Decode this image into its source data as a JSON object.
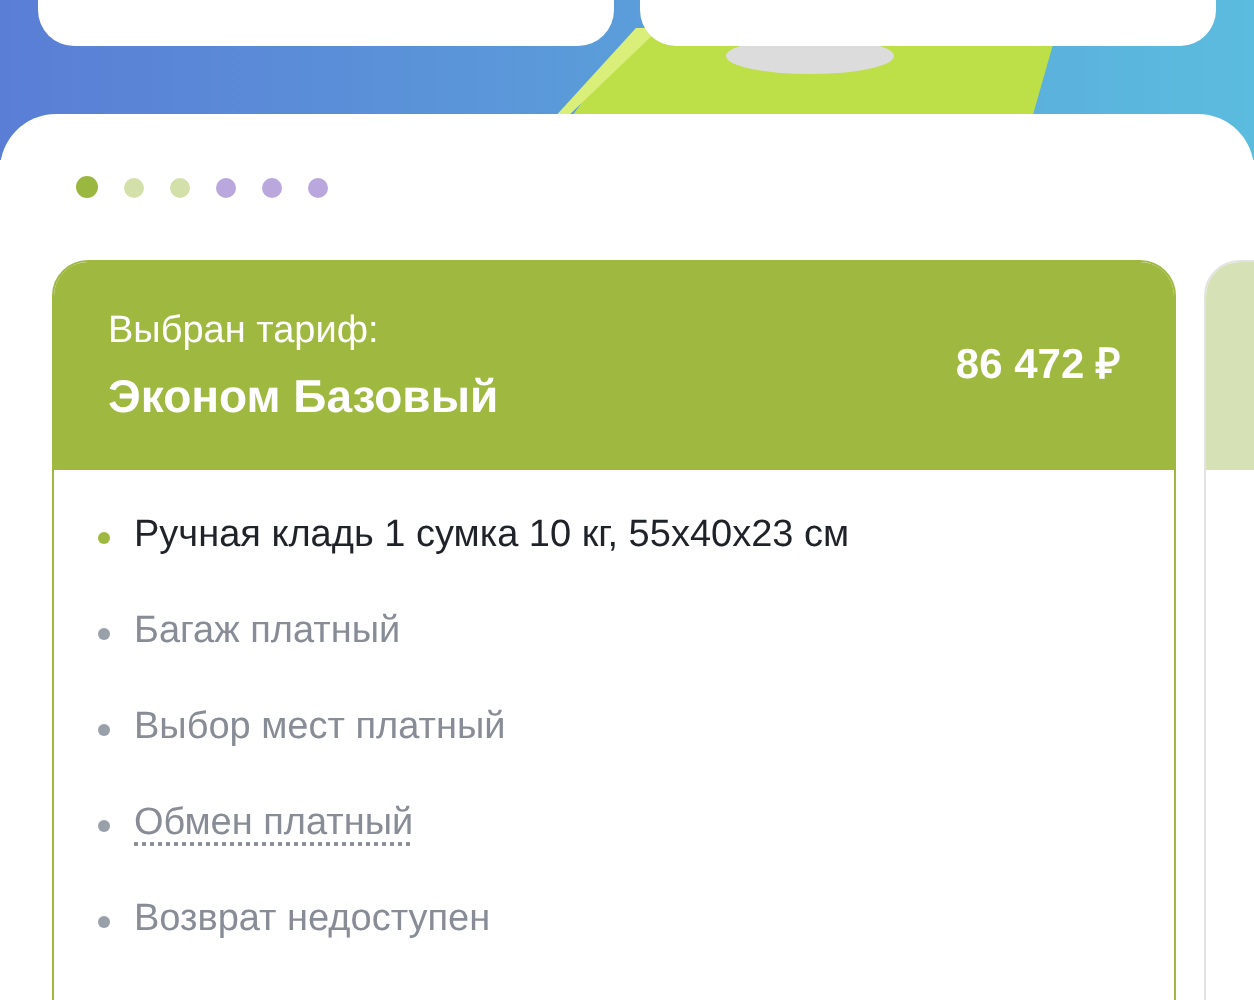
{
  "pager": [
    {
      "selected": true,
      "color": "#9ab83f"
    },
    {
      "selected": false,
      "color": "#d4e0aa"
    },
    {
      "selected": false,
      "color": "#d4e0aa"
    },
    {
      "selected": false,
      "color": "#b9a7dd"
    },
    {
      "selected": false,
      "color": "#b9a7dd"
    },
    {
      "selected": false,
      "color": "#b9a7dd"
    }
  ],
  "tariff": {
    "caption": "Выбран тариф:",
    "name": "Эконом Базовый",
    "price": "86 472 ₽",
    "features": [
      {
        "text": "Ручная кладь 1 сумка 10 кг, 55х40х23 см",
        "included": true,
        "link": false
      },
      {
        "text": "Багаж платный",
        "included": false,
        "link": false
      },
      {
        "text": "Выбор мест платный",
        "included": false,
        "link": false
      },
      {
        "text": "Обмен платный",
        "included": false,
        "link": true
      },
      {
        "text": "Возврат недоступен",
        "included": false,
        "link": false
      }
    ]
  }
}
